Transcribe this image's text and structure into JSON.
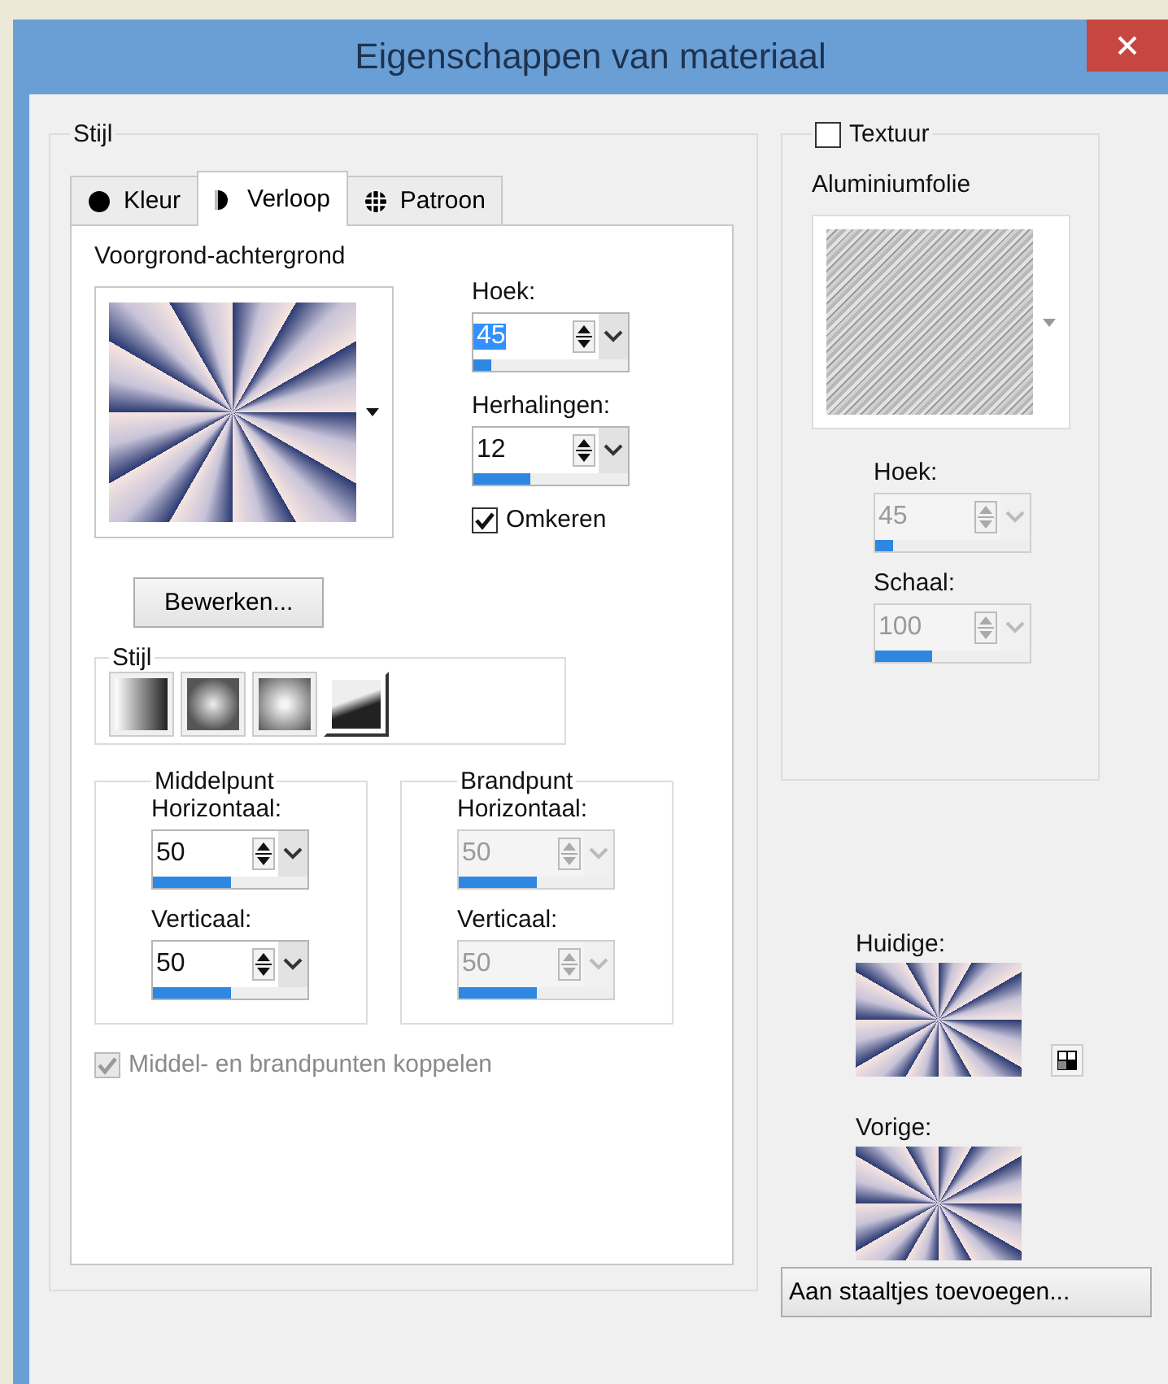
{
  "window": {
    "title": "Eigenschappen van materiaal"
  },
  "style_group": {
    "label": "Stijl",
    "tabs": [
      {
        "label": "Kleur",
        "kind": "color",
        "selected": false
      },
      {
        "label": "Verloop",
        "kind": "gradient",
        "selected": true
      },
      {
        "label": "Patroon",
        "kind": "pattern",
        "selected": false
      }
    ],
    "gradient_name": "Voorgrond-achtergrond",
    "angle": {
      "label": "Hoek:",
      "value": "45",
      "level": 0.12,
      "highlighted": true,
      "disabled": false
    },
    "repeats": {
      "label": "Herhalingen:",
      "value": "12",
      "level": 0.37,
      "highlighted": false,
      "disabled": false
    },
    "edit_button": "Bewerken...",
    "invert": {
      "label": "Omkeren",
      "checked": true,
      "disabled": false
    },
    "style": {
      "label": "Stijl",
      "options": [
        {
          "kind": "linear",
          "selected": false
        },
        {
          "kind": "rectangular",
          "selected": false
        },
        {
          "kind": "radial",
          "selected": false
        },
        {
          "kind": "sunburst",
          "selected": true
        }
      ]
    },
    "center": {
      "label": "Middelpunt",
      "horizontal": {
        "label": "Horizontaal:",
        "value": "50",
        "level": 0.5,
        "highlighted": false,
        "disabled": false
      },
      "vertical": {
        "label": "Verticaal:",
        "value": "50",
        "level": 0.5,
        "highlighted": false,
        "disabled": false
      }
    },
    "focus": {
      "label": "Brandpunt",
      "horizontal": {
        "label": "Horizontaal:",
        "value": "50",
        "level": 0.5,
        "highlighted": false,
        "disabled": true
      },
      "vertical": {
        "label": "Verticaal:",
        "value": "50",
        "level": 0.5,
        "highlighted": false,
        "disabled": true
      }
    },
    "link": {
      "label": "Middel- en brandpunten koppelen",
      "checked": true,
      "disabled": true
    }
  },
  "texture": {
    "label": "Textuur",
    "checked": false,
    "name": "Aluminiumfolie",
    "angle": {
      "label": "Hoek:",
      "value": "45",
      "level": 0.12,
      "highlighted": false,
      "disabled": true
    },
    "scale": {
      "label": "Schaal:",
      "value": "100",
      "level": 0.37,
      "highlighted": false,
      "disabled": true
    }
  },
  "current": {
    "label": "Huidige:"
  },
  "previous": {
    "label": "Vorige:"
  },
  "add_swatch_button": "Aan staaltjes toevoegen..."
}
